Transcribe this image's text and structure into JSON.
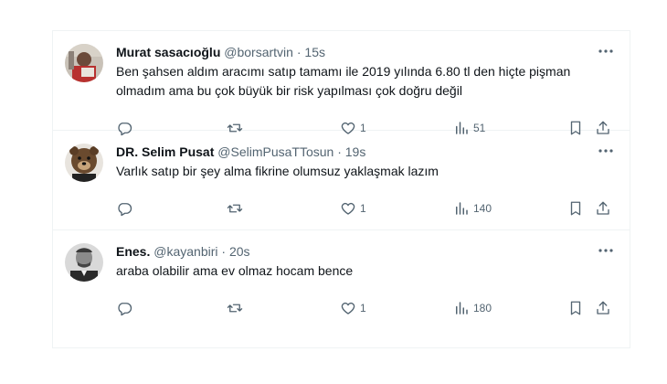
{
  "tweets": [
    {
      "name": "Murat sasacıoğlu",
      "handle": "@borsartvin",
      "dot": "·",
      "time": "15s",
      "text": "Ben şahsen aldım aracımı satıp tamamı ile 2019 yılında 6.80 tl den hiçte pişman olmadım ama bu çok büyük bir risk yapılması çok doğru değil",
      "replies": "",
      "retweets": "",
      "likes": "1",
      "views": "51"
    },
    {
      "name": "DR. Selim Pusat",
      "handle": "@SelimPusaTTosun",
      "dot": "·",
      "time": "19s",
      "text": "Varlık satıp bir şey alma fikrine olumsuz yaklaşmak lazım",
      "replies": "",
      "retweets": "",
      "likes": "1",
      "views": "140"
    },
    {
      "name": "Enes.",
      "handle": "@kayanbiri",
      "dot": "·",
      "time": "20s",
      "text": "araba olabilir ama ev olmaz hocam bence",
      "replies": "",
      "retweets": "",
      "likes": "1",
      "views": "180"
    }
  ],
  "icons": {
    "reply": "reply-icon",
    "retweet": "retweet-icon",
    "like": "heart-icon",
    "views": "views-icon",
    "bookmark": "bookmark-icon",
    "share": "share-icon",
    "more": "more-icon"
  },
  "colors": {
    "text": "#0f1419",
    "secondary": "#536471",
    "border": "#eff3f4"
  }
}
